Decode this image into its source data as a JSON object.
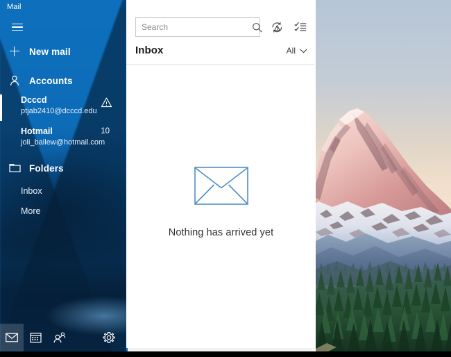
{
  "app": {
    "title": "Mail",
    "accent_color": "#0d6cb8",
    "selection_color": "#ffffff"
  },
  "sidebar": {
    "menu_icon": "hamburger-icon",
    "new_mail": {
      "label": "New mail",
      "icon": "plus-icon"
    },
    "accounts": {
      "label": "Accounts",
      "icon": "person-icon"
    },
    "account_items": [
      {
        "name": "Dcccd",
        "email": "ptjab2410@dcccd.edu",
        "badge": "",
        "status_icon": "warning-triangle-icon",
        "selected": true
      },
      {
        "name": "Hotmail",
        "email": "joli_ballew@hotmail.com",
        "badge": "10",
        "status_icon": "",
        "selected": false
      }
    ],
    "folders": {
      "label": "Folders",
      "icon": "folder-icon"
    },
    "folder_items": [
      {
        "label": "Inbox"
      },
      {
        "label": "More"
      }
    ],
    "appbar": [
      {
        "name": "mail-app-button",
        "icon": "envelope-icon",
        "selected": true
      },
      {
        "name": "calendar-app-button",
        "icon": "calendar-icon",
        "selected": false
      },
      {
        "name": "people-app-button",
        "icon": "people-icon",
        "selected": false
      },
      {
        "name": "settings-button",
        "icon": "gear-icon",
        "selected": false
      }
    ]
  },
  "list_pane": {
    "search": {
      "placeholder": "Search",
      "value": "",
      "button_icon": "search-icon"
    },
    "toolbar": [
      {
        "name": "sync-button",
        "icon": "sync-error-icon"
      },
      {
        "name": "selection-mode-button",
        "icon": "checklist-icon"
      }
    ],
    "header": {
      "title": "Inbox",
      "filter_label": "All",
      "filter_icon": "chevron-down-icon"
    },
    "empty_state": {
      "icon": "envelope-outline-icon",
      "message": "Nothing has arrived yet"
    }
  },
  "photo_pane": {
    "description": "mount-rainier-sunset-forest-photo"
  }
}
